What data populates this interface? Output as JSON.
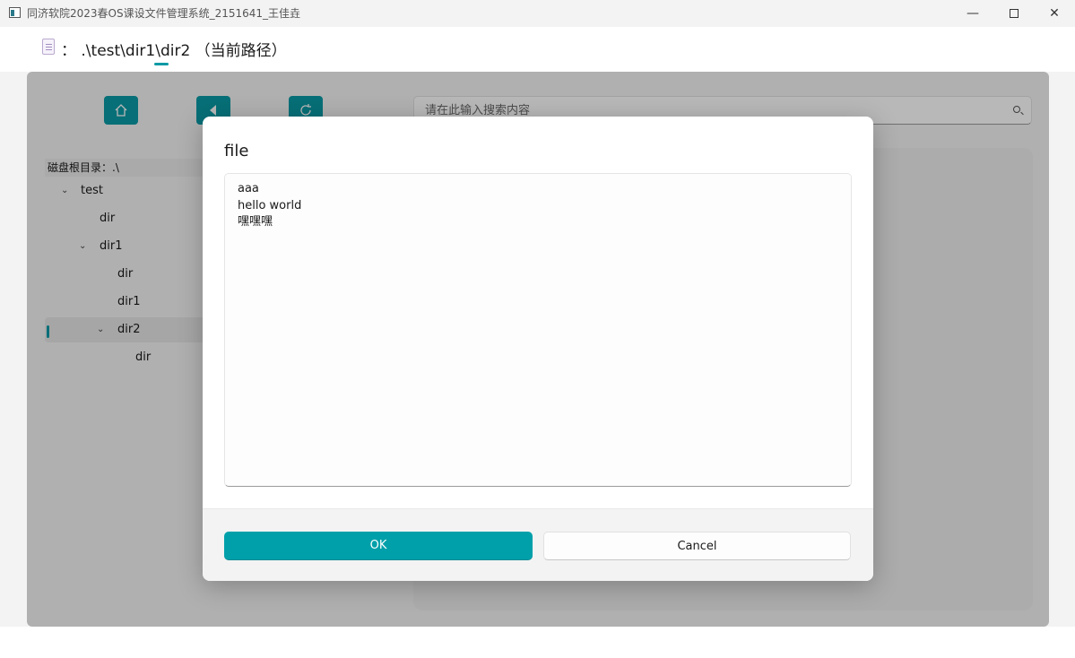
{
  "window": {
    "title": "同济软院2023春OS课设文件管理系统_2151641_王佳垚",
    "minimize": "—",
    "close": "✕"
  },
  "header": {
    "path": "：  .\\test\\dir1\\dir2  （当前路径）"
  },
  "toolbar": {
    "home_icon": "home-icon",
    "back_icon": "back-icon",
    "refresh_icon": "refresh-icon"
  },
  "search": {
    "placeholder": "请在此输入搜索内容"
  },
  "tree": {
    "root_label": "磁盘根目录：.\\",
    "items": [
      {
        "label": "test",
        "level": 1,
        "expanded": true
      },
      {
        "label": "dir",
        "level": 2
      },
      {
        "label": "dir1",
        "level": 2,
        "expanded": true
      },
      {
        "label": "dir",
        "level": 3
      },
      {
        "label": "dir1",
        "level": 3
      },
      {
        "label": "dir2",
        "level": 3,
        "expanded": true,
        "selected": true
      },
      {
        "label": "dir",
        "level": 4
      }
    ]
  },
  "dialog": {
    "title": "file",
    "content_lines": [
      "aaa",
      "hello world",
      "嘿嘿嘿"
    ],
    "ok_label": "OK",
    "cancel_label": "Cancel"
  },
  "colors": {
    "accent": "#00a0aa"
  }
}
